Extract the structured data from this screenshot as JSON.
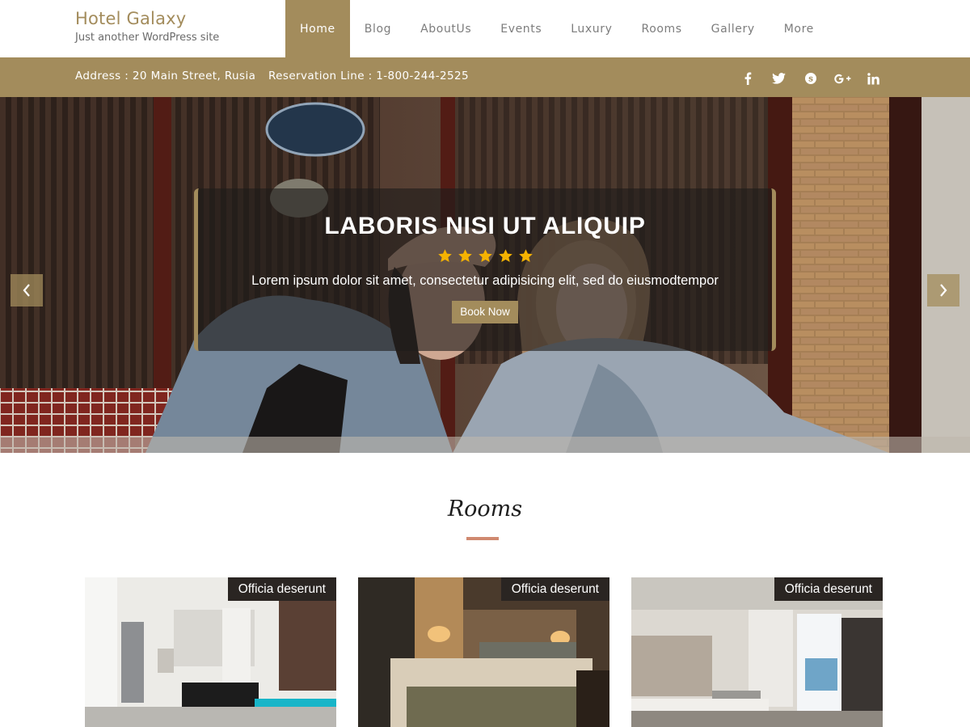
{
  "brand": {
    "title": "Hotel Galaxy",
    "tagline": "Just another WordPress site",
    "accent_color": "#a38c5c"
  },
  "nav": {
    "items": [
      {
        "label": "Home",
        "active": true
      },
      {
        "label": "Blog",
        "active": false
      },
      {
        "label": "AboutUs",
        "active": false
      },
      {
        "label": "Events",
        "active": false
      },
      {
        "label": "Luxury",
        "active": false
      },
      {
        "label": "Rooms",
        "active": false
      },
      {
        "label": "Gallery",
        "active": false
      },
      {
        "label": "More",
        "active": false
      }
    ]
  },
  "infobar": {
    "address": "Address :  20 Main Street, Rusia",
    "reservation": "Reservation Line :  1-800-244-2525",
    "socials": [
      "facebook-icon",
      "twitter-icon",
      "skype-icon",
      "google-plus-icon",
      "linkedin-icon"
    ]
  },
  "hero": {
    "title": "LABORIS NISI UT ALIQUIP",
    "stars": 5,
    "star_color": "#f5b301",
    "text": "Lorem ipsum dolor sit amet, consectetur adipisicing elit, sed do eiusmodtempor",
    "button_label": "Book Now",
    "prev_icon": "chevron-left-icon",
    "next_icon": "chevron-right-icon"
  },
  "rooms": {
    "title": "Rooms",
    "rule_color": "#d08970",
    "cards": [
      {
        "badge": "Officia deserunt"
      },
      {
        "badge": "Officia deserunt"
      },
      {
        "badge": "Officia deserunt"
      }
    ]
  }
}
